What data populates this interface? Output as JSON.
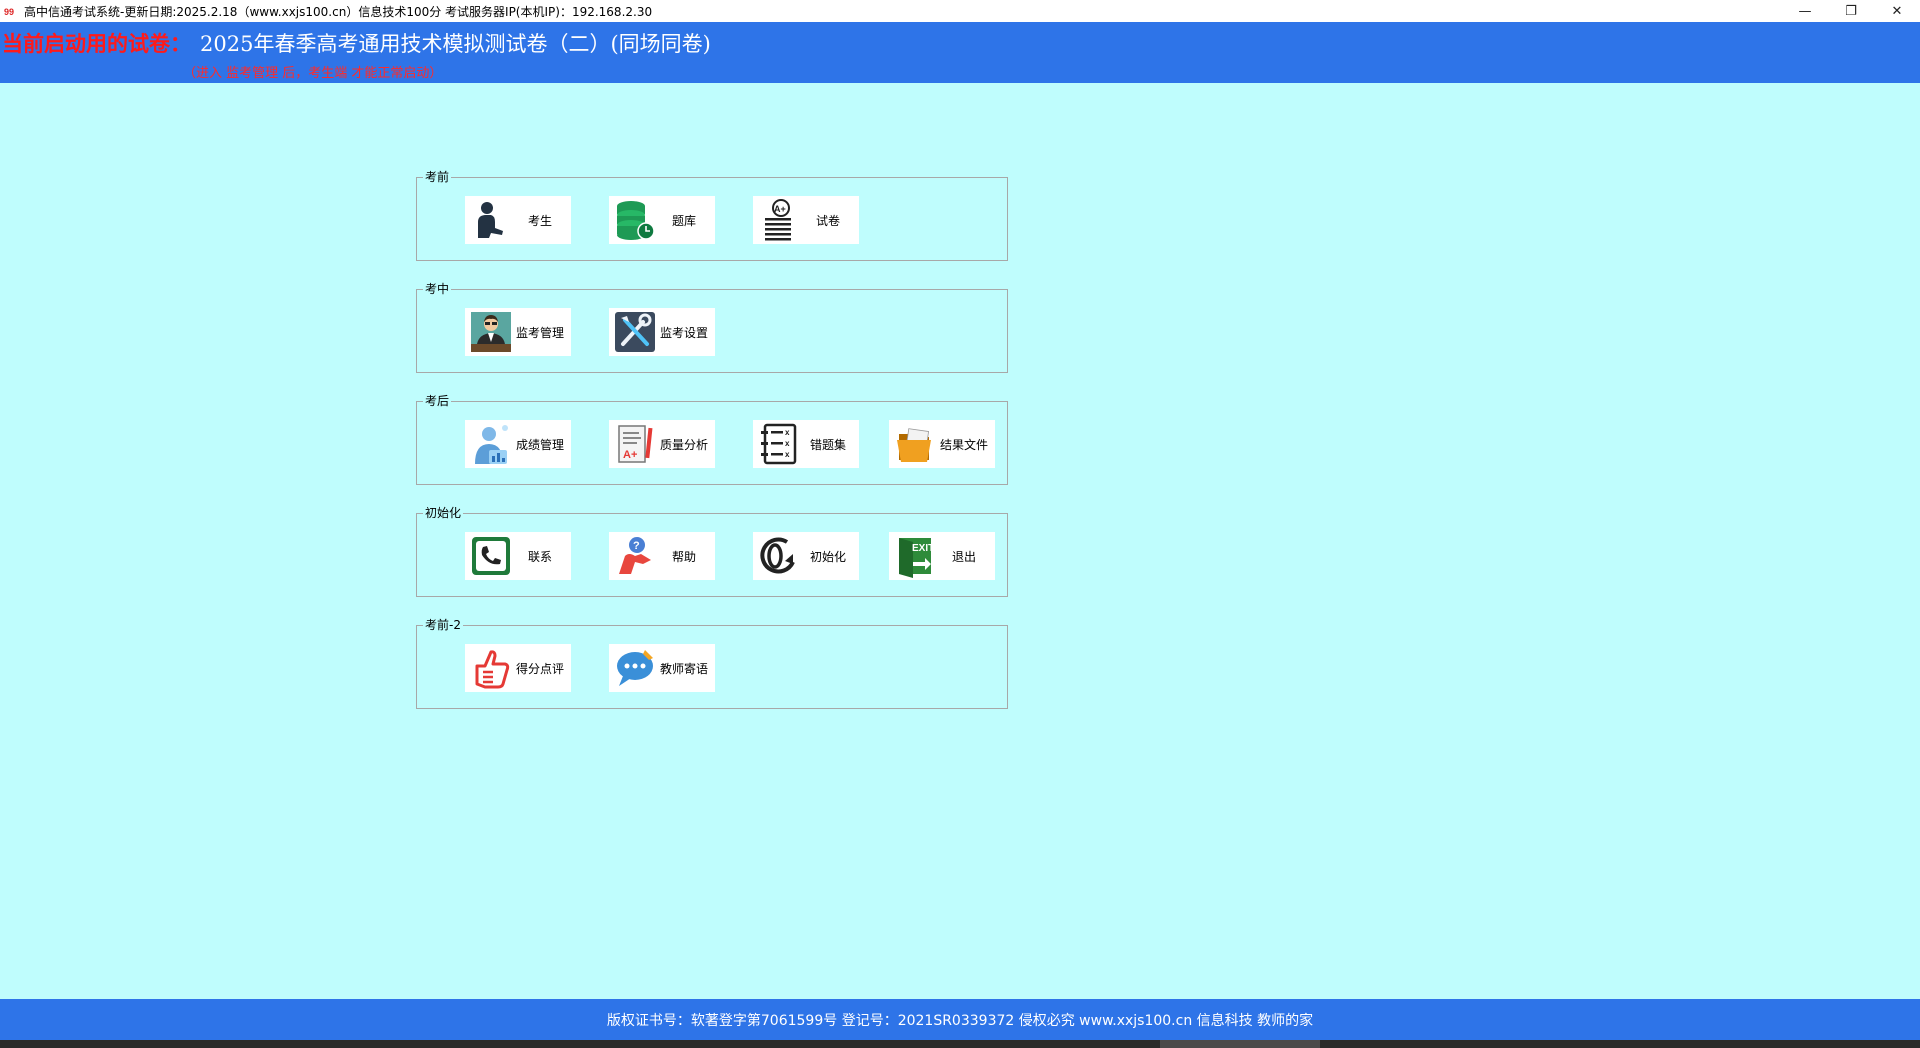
{
  "window": {
    "title": "高中信通考试系统-更新日期:2025.2.18（www.xxjs100.cn）信息技术100分    考试服务器IP(本机IP)：192.168.2.30",
    "controls": {
      "minimize": "—",
      "restore": "❐",
      "close": "✕"
    }
  },
  "header": {
    "current_label": "当前启动用的试卷：",
    "exam_name": "2025年春季高考通用技术模拟测试卷（二）(同场同卷)",
    "hint": "（进入 监考管理 后，考生端 才能正常启动）"
  },
  "groups": [
    {
      "legend": "考前",
      "items": [
        {
          "label": "考生",
          "icon": "student-icon"
        },
        {
          "label": "题库",
          "icon": "database-icon"
        },
        {
          "label": "试卷",
          "icon": "exam-paper-icon"
        }
      ]
    },
    {
      "legend": "考中",
      "items": [
        {
          "label": "监考管理",
          "icon": "proctor-icon"
        },
        {
          "label": "监考设置",
          "icon": "tools-icon"
        }
      ]
    },
    {
      "legend": "考后",
      "items": [
        {
          "label": "成绩管理",
          "icon": "score-management-icon"
        },
        {
          "label": "质量分析",
          "icon": "quality-analysis-icon"
        },
        {
          "label": "错题集",
          "icon": "wrong-questions-icon"
        },
        {
          "label": "结果文件",
          "icon": "folder-icon"
        }
      ]
    },
    {
      "legend": "初始化",
      "items": [
        {
          "label": "联系",
          "icon": "phone-icon"
        },
        {
          "label": "帮助",
          "icon": "help-icon"
        },
        {
          "label": "初始化",
          "icon": "reset-icon"
        },
        {
          "label": "退出",
          "icon": "exit-icon"
        }
      ]
    },
    {
      "legend": "考前-2",
      "items": [
        {
          "label": "得分点评",
          "icon": "thumbs-up-icon"
        },
        {
          "label": "教师寄语",
          "icon": "chat-bubble-icon"
        }
      ]
    }
  ],
  "footer": {
    "text": "版权证书号：软著登字第7061599号 登记号：2021SR0339372  侵权必究  www.xxjs100.cn  信息科技 教师的家"
  },
  "colors": {
    "header_bg": "#2e74e8",
    "page_bg": "#bffdfd",
    "accent_red": "#ff1a1a"
  }
}
